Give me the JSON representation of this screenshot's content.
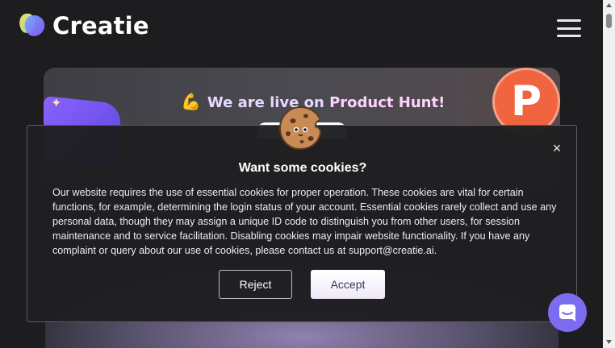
{
  "header": {
    "brand": "Creatie",
    "menu_icon": "hamburger-menu-icon"
  },
  "banner": {
    "title_prefix": "We are live on ",
    "title_highlight": "Product Hunt!",
    "emoji_icon": "flexed-biceps-icon",
    "badge_letter": "P"
  },
  "cookie_modal": {
    "icon": "cookie-icon",
    "title": "Want some cookies?",
    "body": "Our website requires the use of essential cookies for proper operation. These cookies are vital for certain functions, for example, determining the login status of your account. Essential cookies rarely collect and use any personal data, though they may assign a unique ID code to distinguish you from other users, for session maintenance and to service facilitation. Disabling cookies may impair website functionality. If you have any complaint or query about our use of cookies, please contact us at support@creatie.ai.",
    "close_label": "×",
    "reject_label": "Reject",
    "accept_label": "Accept"
  },
  "chat": {
    "icon": "chat-bubble-icon"
  },
  "colors": {
    "background": "#1d1d1f",
    "accent": "#7b6cf0",
    "product_hunt": "#f0643f"
  }
}
